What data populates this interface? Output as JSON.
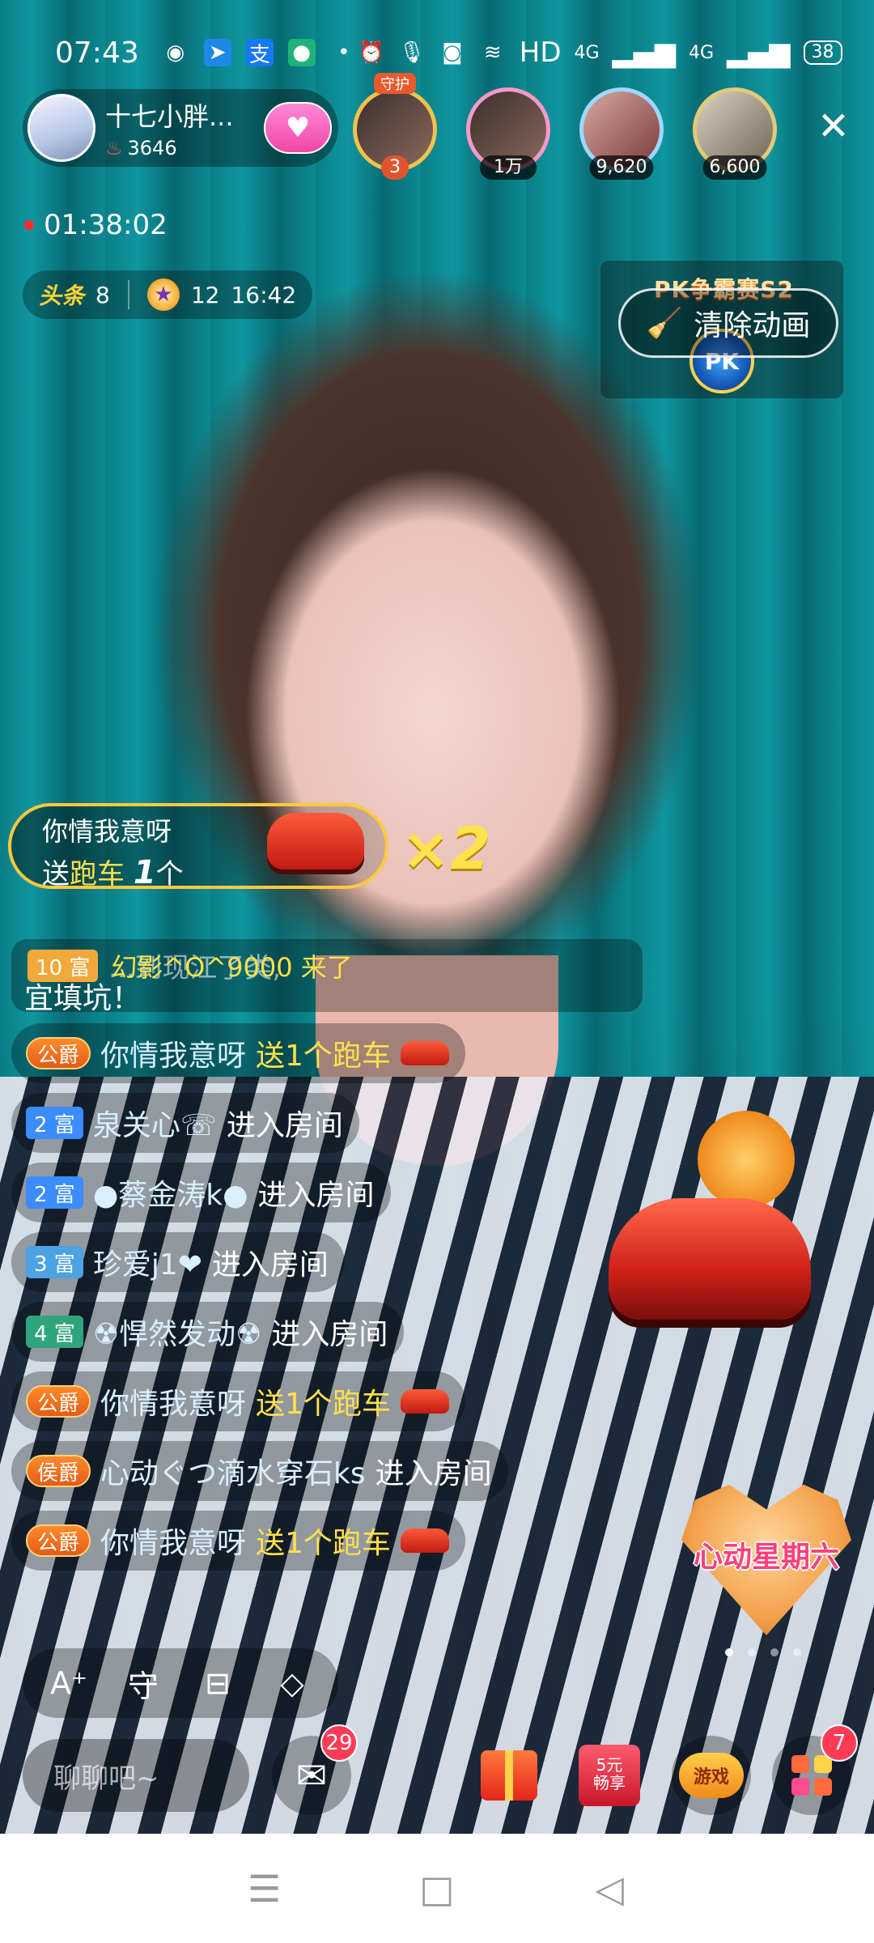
{
  "status_bar": {
    "time": "07:43",
    "network_label": "HD",
    "signal_1": "4G",
    "signal_2": "4G",
    "battery": "38",
    "left_icons": [
      "wechat-icon",
      "paper-plane-icon",
      "alipay-icon",
      "chat-bubble-icon",
      "dot-icon"
    ],
    "right_icons": [
      "alarm-icon",
      "mic-icon",
      "camera-icon",
      "wifi-icon"
    ]
  },
  "host": {
    "name": "十七小胖...",
    "heat": "3646",
    "heat_icon": "flame-icon",
    "follow_icon": "heart-icon"
  },
  "top_fans": [
    {
      "label": "3",
      "crown": "守护"
    },
    {
      "label": "1万"
    },
    {
      "label": "9,620"
    },
    {
      "label": "6,600"
    }
  ],
  "live_timer": "01:38:02",
  "stats": {
    "toutiao_label": "头条",
    "toutiao_count": "8",
    "star_level": "12",
    "star_time": "16:42"
  },
  "pk": {
    "title": "PK争霸赛S2",
    "logo_label": "PK",
    "clear_animation_label": "清除动画"
  },
  "gift_banner": {
    "sender": "你情我意呀",
    "line_prefix": "送",
    "gift_name": "跑车",
    "count": "1",
    "unit": "个",
    "combo": "×2"
  },
  "notice": {
    "ghost_text": "...到现江了类,",
    "ghost_text_2": "宜填坑！",
    "entry_level": "10 富",
    "entry_text": "幻影^O^9000 来了"
  },
  "chat_messages": [
    {
      "badge": "公爵",
      "badge_type": "noble",
      "user": "你情我意呀",
      "text": "送1个跑车",
      "gift": true
    },
    {
      "badge": "2 富",
      "badge_type": "fu",
      "user": "泉关心☏",
      "text": "进入房间"
    },
    {
      "badge": "2 富",
      "badge_type": "fu",
      "user": "●蔡金涛k●",
      "text": "进入房间"
    },
    {
      "badge": "3 富",
      "badge_type": "fu3",
      "user": "珍爱j1❤",
      "text": "进入房间"
    },
    {
      "badge": "4 富",
      "badge_type": "fu4",
      "user": "☢悍然发动☢",
      "text": "进入房间"
    },
    {
      "badge": "公爵",
      "badge_type": "noble",
      "user": "你情我意呀",
      "text": "送1个跑车",
      "gift": true
    },
    {
      "badge": "侯爵",
      "badge_type": "noble",
      "user": "心动ぐつ滴水穿石ks",
      "text": "进入房间"
    },
    {
      "badge": "公爵",
      "badge_type": "noble",
      "user": "你情我意呀",
      "text": "送1个跑车",
      "gift": true
    }
  ],
  "event": {
    "label": "心动星期六"
  },
  "toolbar": {
    "items": [
      "font-size-icon",
      "guard-icon",
      "fan-club-icon",
      "tag-icon"
    ],
    "glyphs": [
      "A⁺",
      "守",
      "⊟",
      "◇"
    ]
  },
  "bottom": {
    "chat_placeholder": "聊聊吧~",
    "mail_count": "29",
    "deal_text_1": "5元",
    "deal_text_2": "畅享",
    "game_label": "游戏",
    "more_count": "7"
  },
  "nav": {
    "menu_glyph": "☰",
    "home_glyph": "□",
    "back_glyph": "◁"
  }
}
